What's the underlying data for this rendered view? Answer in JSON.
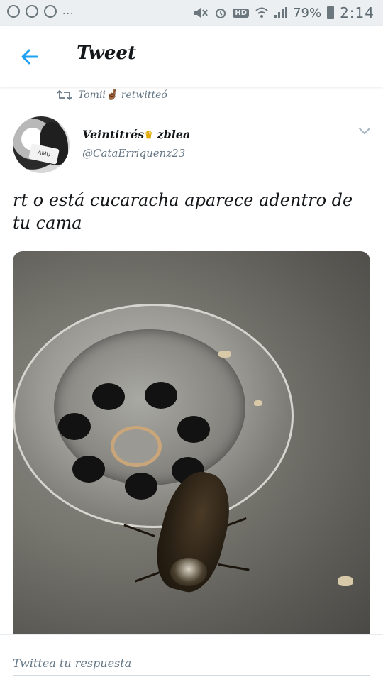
{
  "status_bar": {
    "icons_left": [
      "whatsapp-icon",
      "chrome-icon",
      "camera-icon"
    ],
    "more": "...",
    "hd": "HD",
    "battery_pct": "79%",
    "time": "2:14"
  },
  "header": {
    "title": "Tweet"
  },
  "retweet": {
    "text": "Tomii🤞🏾 retwitteó"
  },
  "tweet": {
    "display_name": "Veintitrés",
    "display_name_suffix": "zblea",
    "handle": "@CataErriquenz23",
    "text": "rt o está cucaracha aparece adentro de tu cama"
  },
  "reply": {
    "placeholder": "Twittea tu respuesta"
  },
  "colors": {
    "accent": "#1da1f2",
    "text": "#14171a",
    "muted": "#657786"
  }
}
